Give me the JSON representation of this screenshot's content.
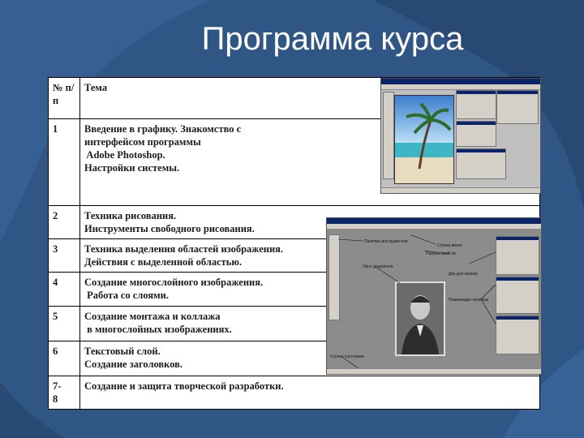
{
  "slide": {
    "title": "Программа курса"
  },
  "table": {
    "header": {
      "num": "№ п/п",
      "topic": "Тема"
    },
    "rows": [
      {
        "num": "1",
        "lines": [
          "Введение в графику. Знакомство с",
          "интерфейсом программы",
          " Adobe Photoshop.",
          "Настройки системы."
        ]
      },
      {
        "num": "2",
        "lines": [
          "Техника рисования.",
          "Инструменты свободного рисования."
        ]
      },
      {
        "num": "3",
        "lines": [
          "Техника выделения областей изображения.",
          "Действия с выделенной областью."
        ]
      },
      {
        "num": "4",
        "lines": [
          "Создание многослойного изображения.",
          " Работа со слоями."
        ]
      },
      {
        "num": "5",
        "lines": [
          "Создание монтажа и коллажа",
          " в многослойных изображениях."
        ]
      },
      {
        "num": "6",
        "lines": [
          "Текстовый слой.",
          "Создание заголовков."
        ]
      },
      {
        "num": "7-\n8",
        "lines": [
          "Создание и защита творческой разработки."
        ]
      }
    ]
  },
  "screenshot2": {
    "callouts": {
      "tools": "Палитра инструментов",
      "menu": "Строка меню",
      "props": "Панель свойств",
      "doc": "Окно документа",
      "dock": "Док для палитр",
      "floating": "Плавающие палитры",
      "status": "Строка состояния"
    }
  },
  "colors": {
    "background": "#2f5685",
    "title": "#ffffff",
    "table_bg": "#ffffff"
  }
}
